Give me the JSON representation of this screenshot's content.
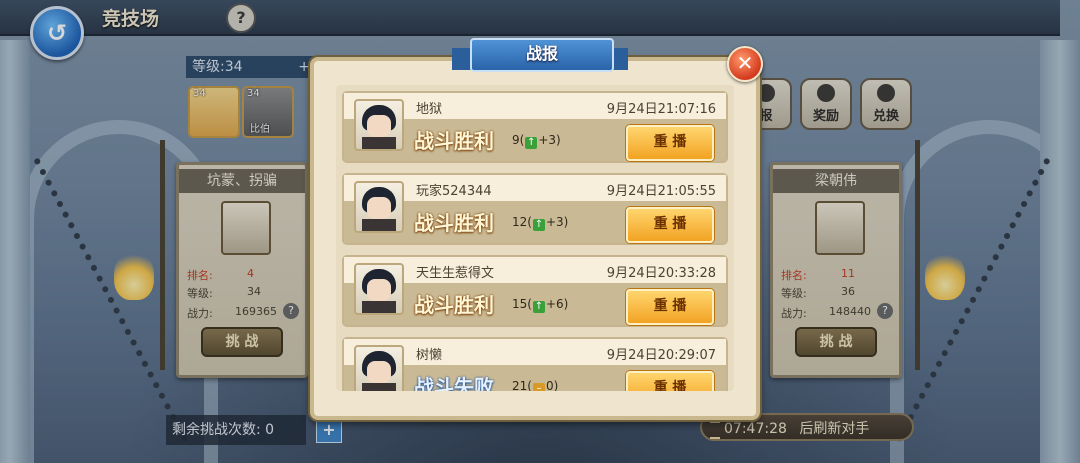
{
  "topbar": {
    "title": "竞技场",
    "help": "?"
  },
  "player": {
    "level_label": "等级:34",
    "level_plus": "+"
  },
  "heroes": [
    {
      "level": "34"
    },
    {
      "level": "34",
      "tag": "比伯"
    }
  ],
  "opponents": [
    {
      "name": "坑蒙、拐骗",
      "rank_label": "排名:",
      "rank": "4",
      "level_label": "等级:",
      "level": "34",
      "power_label": "战力:",
      "power": "169365",
      "button": "挑 战"
    },
    {
      "name": "梁朝伟",
      "rank_label": "排名:",
      "rank": "11",
      "level_label": "等级:",
      "level": "36",
      "power_label": "战力:",
      "power": "148440",
      "button": "挑 战"
    }
  ],
  "actions": [
    {
      "label": "报",
      "icon": "report-icon"
    },
    {
      "label": "奖励",
      "icon": "reward-icon"
    },
    {
      "label": "兑换",
      "icon": "exchange-icon"
    }
  ],
  "bottom": {
    "remaining": "剩余挑战次数: 0",
    "plus": "+",
    "timer": "07:47:28",
    "refresh": "后刷新对手"
  },
  "modal": {
    "title": "战报",
    "close": "✕",
    "records": [
      {
        "name": "地狱",
        "time": "9月24日21:07:16",
        "result": "战斗胜利",
        "rank": "9",
        "delta": "+3",
        "trend": "up",
        "replay": "重 播"
      },
      {
        "name": "玩家524344",
        "time": "9月24日21:05:55",
        "result": "战斗胜利",
        "rank": "12",
        "delta": "+3",
        "trend": "up",
        "replay": "重 播"
      },
      {
        "name": "天生生惹得文",
        "time": "9月24日20:33:28",
        "result": "战斗胜利",
        "rank": "15",
        "delta": "+6",
        "trend": "up",
        "replay": "重 播"
      },
      {
        "name": "树懒",
        "time": "9月24日20:29:07",
        "result": "战斗失败",
        "rank": "21",
        "delta": "0",
        "trend": "flat",
        "replay": "重 播"
      }
    ]
  },
  "colors": {
    "win": "#fff6d6",
    "lose": "#e6f1ff",
    "replay": "#f2a323",
    "ribbon": "#2a63a8"
  }
}
